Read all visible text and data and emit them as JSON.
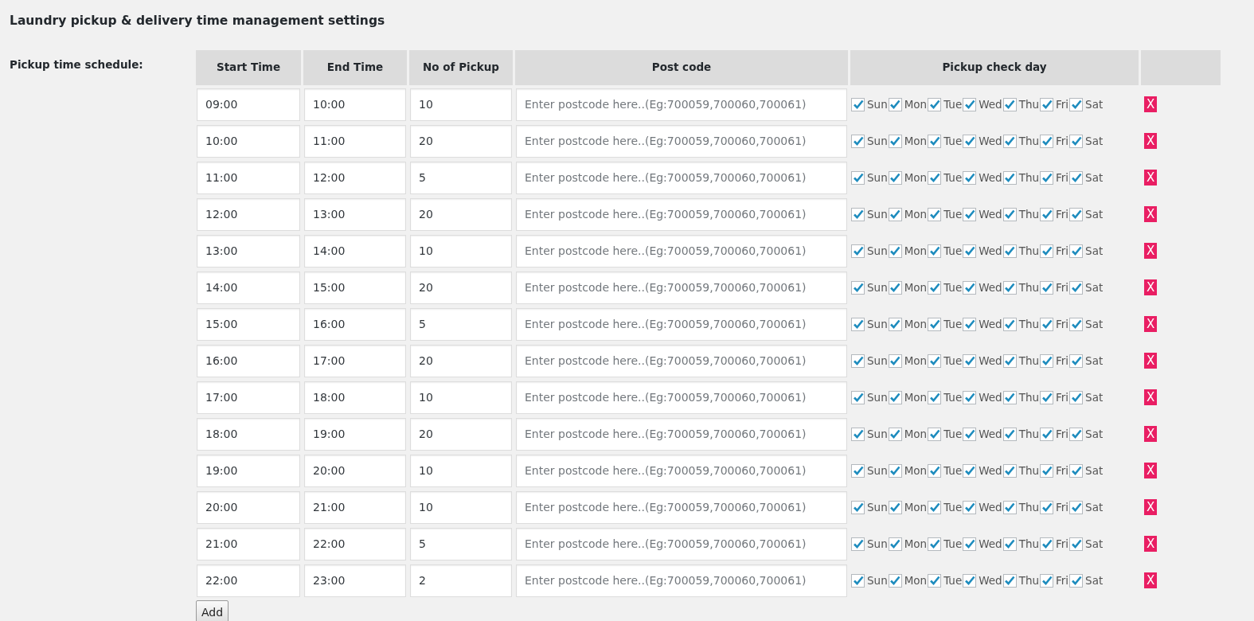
{
  "page_title": "Laundry pickup & delivery time management settings",
  "field_label": "Pickup time schedule:",
  "table": {
    "columns": [
      "Start Time",
      "End Time",
      "No of Pickup",
      "Post code",
      "Pickup check day"
    ],
    "rows": [
      {
        "start": "09:00",
        "end": "10:00",
        "pickups": "10",
        "postcode": {
          "placeholder": "Enter postcode here..(Eg:700059,700060,700061)"
        },
        "days": [
          {
            "label": "Sun",
            "checked": true
          },
          {
            "label": "Mon",
            "checked": true
          },
          {
            "label": "Tue",
            "checked": true
          },
          {
            "label": "Wed",
            "checked": true
          },
          {
            "label": "Thu",
            "checked": true
          },
          {
            "label": "Fri",
            "checked": true
          },
          {
            "label": "Sat",
            "checked": true
          }
        ],
        "remove": "X"
      },
      {
        "start": "10:00",
        "end": "11:00",
        "pickups": "20",
        "postcode": {
          "placeholder": "Enter postcode here..(Eg:700059,700060,700061)"
        },
        "days": [
          {
            "label": "Sun",
            "checked": true
          },
          {
            "label": "Mon",
            "checked": true
          },
          {
            "label": "Tue",
            "checked": true
          },
          {
            "label": "Wed",
            "checked": true
          },
          {
            "label": "Thu",
            "checked": true
          },
          {
            "label": "Fri",
            "checked": true
          },
          {
            "label": "Sat",
            "checked": true
          }
        ],
        "remove": "X"
      },
      {
        "start": "11:00",
        "end": "12:00",
        "pickups": "5",
        "postcode": {
          "placeholder": "Enter postcode here..(Eg:700059,700060,700061)"
        },
        "days": [
          {
            "label": "Sun",
            "checked": true
          },
          {
            "label": "Mon",
            "checked": true
          },
          {
            "label": "Tue",
            "checked": true
          },
          {
            "label": "Wed",
            "checked": true
          },
          {
            "label": "Thu",
            "checked": true
          },
          {
            "label": "Fri",
            "checked": true
          },
          {
            "label": "Sat",
            "checked": true
          }
        ],
        "remove": "X"
      },
      {
        "start": "12:00",
        "end": "13:00",
        "pickups": "20",
        "postcode": {
          "placeholder": "Enter postcode here..(Eg:700059,700060,700061)"
        },
        "days": [
          {
            "label": "Sun",
            "checked": true
          },
          {
            "label": "Mon",
            "checked": true
          },
          {
            "label": "Tue",
            "checked": true
          },
          {
            "label": "Wed",
            "checked": true
          },
          {
            "label": "Thu",
            "checked": true
          },
          {
            "label": "Fri",
            "checked": true
          },
          {
            "label": "Sat",
            "checked": true
          }
        ],
        "remove": "X"
      },
      {
        "start": "13:00",
        "end": "14:00",
        "pickups": "10",
        "postcode": {
          "placeholder": "Enter postcode here..(Eg:700059,700060,700061)"
        },
        "days": [
          {
            "label": "Sun",
            "checked": true
          },
          {
            "label": "Mon",
            "checked": true
          },
          {
            "label": "Tue",
            "checked": true
          },
          {
            "label": "Wed",
            "checked": true
          },
          {
            "label": "Thu",
            "checked": true
          },
          {
            "label": "Fri",
            "checked": true
          },
          {
            "label": "Sat",
            "checked": true
          }
        ],
        "remove": "X"
      },
      {
        "start": "14:00",
        "end": "15:00",
        "pickups": "20",
        "postcode": {
          "placeholder": "Enter postcode here..(Eg:700059,700060,700061)"
        },
        "days": [
          {
            "label": "Sun",
            "checked": true
          },
          {
            "label": "Mon",
            "checked": true
          },
          {
            "label": "Tue",
            "checked": true
          },
          {
            "label": "Wed",
            "checked": true
          },
          {
            "label": "Thu",
            "checked": true
          },
          {
            "label": "Fri",
            "checked": true
          },
          {
            "label": "Sat",
            "checked": true
          }
        ],
        "remove": "X"
      },
      {
        "start": "15:00",
        "end": "16:00",
        "pickups": "5",
        "postcode": {
          "placeholder": "Enter postcode here..(Eg:700059,700060,700061)"
        },
        "days": [
          {
            "label": "Sun",
            "checked": true
          },
          {
            "label": "Mon",
            "checked": true
          },
          {
            "label": "Tue",
            "checked": true
          },
          {
            "label": "Wed",
            "checked": true
          },
          {
            "label": "Thu",
            "checked": true
          },
          {
            "label": "Fri",
            "checked": true
          },
          {
            "label": "Sat",
            "checked": true
          }
        ],
        "remove": "X"
      },
      {
        "start": "16:00",
        "end": "17:00",
        "pickups": "20",
        "postcode": {
          "placeholder": "Enter postcode here..(Eg:700059,700060,700061)"
        },
        "days": [
          {
            "label": "Sun",
            "checked": true
          },
          {
            "label": "Mon",
            "checked": true
          },
          {
            "label": "Tue",
            "checked": true
          },
          {
            "label": "Wed",
            "checked": true
          },
          {
            "label": "Thu",
            "checked": true
          },
          {
            "label": "Fri",
            "checked": true
          },
          {
            "label": "Sat",
            "checked": true
          }
        ],
        "remove": "X"
      },
      {
        "start": "17:00",
        "end": "18:00",
        "pickups": "10",
        "postcode": {
          "placeholder": "Enter postcode here..(Eg:700059,700060,700061)"
        },
        "days": [
          {
            "label": "Sun",
            "checked": true
          },
          {
            "label": "Mon",
            "checked": true
          },
          {
            "label": "Tue",
            "checked": true
          },
          {
            "label": "Wed",
            "checked": true
          },
          {
            "label": "Thu",
            "checked": true
          },
          {
            "label": "Fri",
            "checked": true
          },
          {
            "label": "Sat",
            "checked": true
          }
        ],
        "remove": "X"
      },
      {
        "start": "18:00",
        "end": "19:00",
        "pickups": "20",
        "postcode": {
          "placeholder": "Enter postcode here..(Eg:700059,700060,700061)"
        },
        "days": [
          {
            "label": "Sun",
            "checked": true
          },
          {
            "label": "Mon",
            "checked": true
          },
          {
            "label": "Tue",
            "checked": true
          },
          {
            "label": "Wed",
            "checked": true
          },
          {
            "label": "Thu",
            "checked": true
          },
          {
            "label": "Fri",
            "checked": true
          },
          {
            "label": "Sat",
            "checked": true
          }
        ],
        "remove": "X"
      },
      {
        "start": "19:00",
        "end": "20:00",
        "pickups": "10",
        "postcode": {
          "placeholder": "Enter postcode here..(Eg:700059,700060,700061)"
        },
        "days": [
          {
            "label": "Sun",
            "checked": true
          },
          {
            "label": "Mon",
            "checked": true
          },
          {
            "label": "Tue",
            "checked": true
          },
          {
            "label": "Wed",
            "checked": true
          },
          {
            "label": "Thu",
            "checked": true
          },
          {
            "label": "Fri",
            "checked": true
          },
          {
            "label": "Sat",
            "checked": true
          }
        ],
        "remove": "X"
      },
      {
        "start": "20:00",
        "end": "21:00",
        "pickups": "10",
        "postcode": {
          "placeholder": "Enter postcode here..(Eg:700059,700060,700061)"
        },
        "days": [
          {
            "label": "Sun",
            "checked": true
          },
          {
            "label": "Mon",
            "checked": true
          },
          {
            "label": "Tue",
            "checked": true
          },
          {
            "label": "Wed",
            "checked": true
          },
          {
            "label": "Thu",
            "checked": true
          },
          {
            "label": "Fri",
            "checked": true
          },
          {
            "label": "Sat",
            "checked": true
          }
        ],
        "remove": "X"
      },
      {
        "start": "21:00",
        "end": "22:00",
        "pickups": "5",
        "postcode": {
          "placeholder": "Enter postcode here..(Eg:700059,700060,700061)"
        },
        "days": [
          {
            "label": "Sun",
            "checked": true
          },
          {
            "label": "Mon",
            "checked": true
          },
          {
            "label": "Tue",
            "checked": true
          },
          {
            "label": "Wed",
            "checked": true
          },
          {
            "label": "Thu",
            "checked": true
          },
          {
            "label": "Fri",
            "checked": true
          },
          {
            "label": "Sat",
            "checked": true
          }
        ],
        "remove": "X"
      },
      {
        "start": "22:00",
        "end": "23:00",
        "pickups": "2",
        "postcode": {
          "placeholder": "Enter postcode here..(Eg:700059,700060,700061)"
        },
        "days": [
          {
            "label": "Sun",
            "checked": true
          },
          {
            "label": "Mon",
            "checked": true
          },
          {
            "label": "Tue",
            "checked": true
          },
          {
            "label": "Wed",
            "checked": true
          },
          {
            "label": "Thu",
            "checked": true
          },
          {
            "label": "Fri",
            "checked": true
          },
          {
            "label": "Sat",
            "checked": true
          }
        ],
        "remove": "X"
      }
    ]
  },
  "add_button": "Add"
}
